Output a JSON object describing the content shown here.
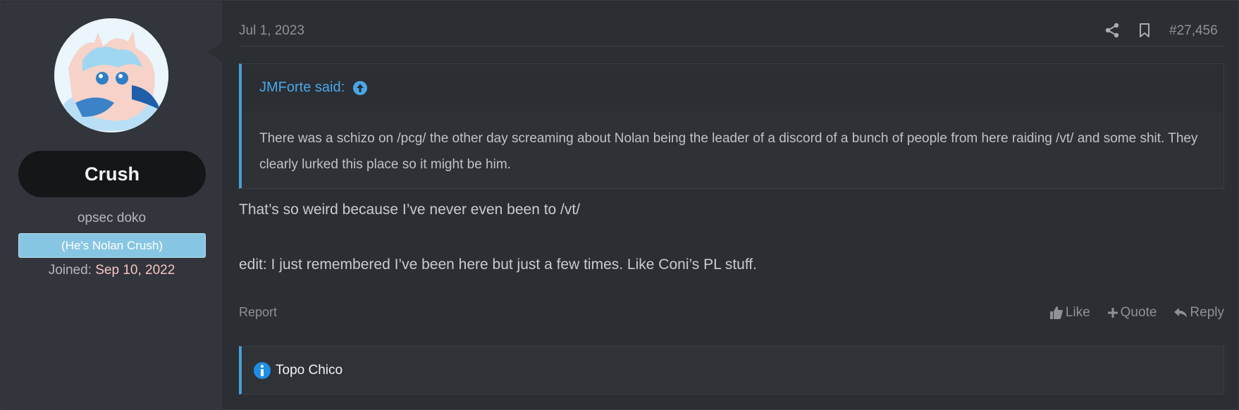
{
  "user": {
    "username": "Crush",
    "title": "opsec doko",
    "banner": "(He's Nolan Crush)",
    "joined_label": "Joined:",
    "joined_date": "Sep 10, 2022"
  },
  "post": {
    "date": "Jul 1, 2023",
    "number": "#27,456",
    "quote": {
      "author": "JMForte said:",
      "text": "There was a schizo on /pcg/ the other day screaming about Nolan being the leader of a discord of a bunch of people from here raiding /vt/ and some shit. They clearly lurked this place so it might be him."
    },
    "message_line_1": "That’s so weird because I’ve never even been to /vt/",
    "message_line_2": "edit: I just remembered I’ve been here but just a few times. Like Coni’s PL stuff."
  },
  "actions": {
    "report": "Report",
    "like": "Like",
    "quote": "Quote",
    "reply": "Reply"
  },
  "notice": {
    "text": "Topo Chico"
  },
  "colors": {
    "accent_blue": "#4a9ed6",
    "banner_bg": "#87c6e2",
    "joined_date": "#f6c3c3",
    "page_bg": "#2b2e33"
  },
  "icons": {
    "share": "share-icon",
    "bookmark": "bookmark-icon",
    "quote_up": "arrow-up-circle-icon",
    "like": "thumbs-up-icon",
    "quote": "plus-icon",
    "reply": "reply-icon",
    "notice": "info-icon"
  }
}
